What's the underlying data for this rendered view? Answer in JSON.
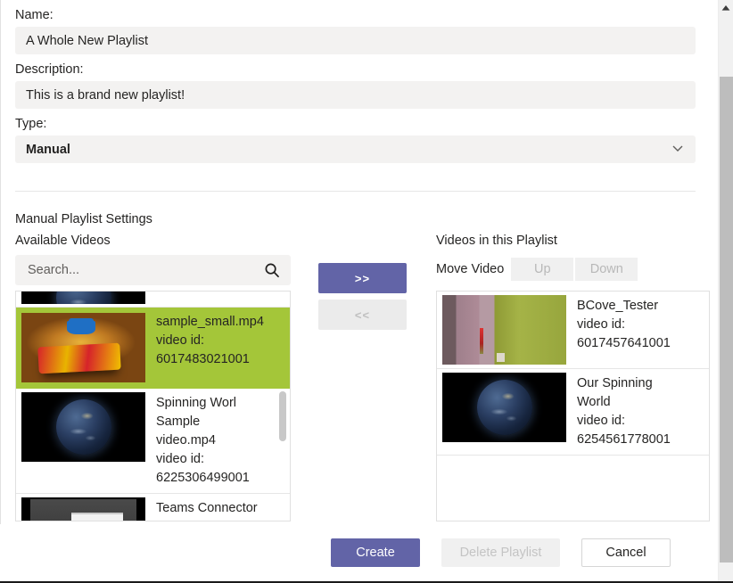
{
  "form": {
    "name_label": "Name:",
    "name_value": "A Whole New Playlist",
    "description_label": "Description:",
    "description_value": "This is a brand new playlist!",
    "type_label": "Type:",
    "type_value": "Manual",
    "type_chevron": "chevron-down-icon"
  },
  "settings": {
    "section_title": "Manual Playlist Settings",
    "available_title": "Available Videos",
    "playlist_title": "Videos in this Playlist"
  },
  "search": {
    "placeholder": "Search...",
    "value": "",
    "icon": "search-icon"
  },
  "transfer": {
    "add_label": ">>",
    "remove_label": "<<"
  },
  "move": {
    "label": "Move Video",
    "up_label": "Up",
    "down_label": "Down"
  },
  "available_videos": [
    {
      "title": "",
      "id_label": "",
      "id": "",
      "thumb": "earth-thumbnail",
      "selected": false,
      "clipped": "top"
    },
    {
      "title": "sample_small.mp4",
      "id_label": "video id:",
      "id": "6017483021001",
      "thumb": "lego-thumbnail",
      "selected": true,
      "clipped": "none"
    },
    {
      "title": "Spinning Worl Sample video.mp4",
      "id_label": "video id:",
      "id": "6225306499001",
      "thumb": "earth-thumbnail",
      "selected": false,
      "clipped": "none"
    },
    {
      "title": "Teams Connector Walkthrough-",
      "id_label": "",
      "id": "",
      "thumb": "teams-thumbnail",
      "selected": false,
      "clipped": "bottom"
    }
  ],
  "playlist_videos": [
    {
      "title": "BCove_Tester",
      "id_label": "video id:",
      "id": "6017457641001",
      "thumb": "room-thumbnail"
    },
    {
      "title": "Our Spinning World",
      "id_label": "video id:",
      "id": "6254561778001",
      "thumb": "earth-thumbnail"
    }
  ],
  "footer": {
    "create_label": "Create",
    "delete_label": "Delete Playlist",
    "cancel_label": "Cancel"
  },
  "colors": {
    "accent_purple": "#6264a7",
    "selection_green": "#a4c639",
    "field_gray": "#f3f2f1",
    "text": "#252423"
  }
}
